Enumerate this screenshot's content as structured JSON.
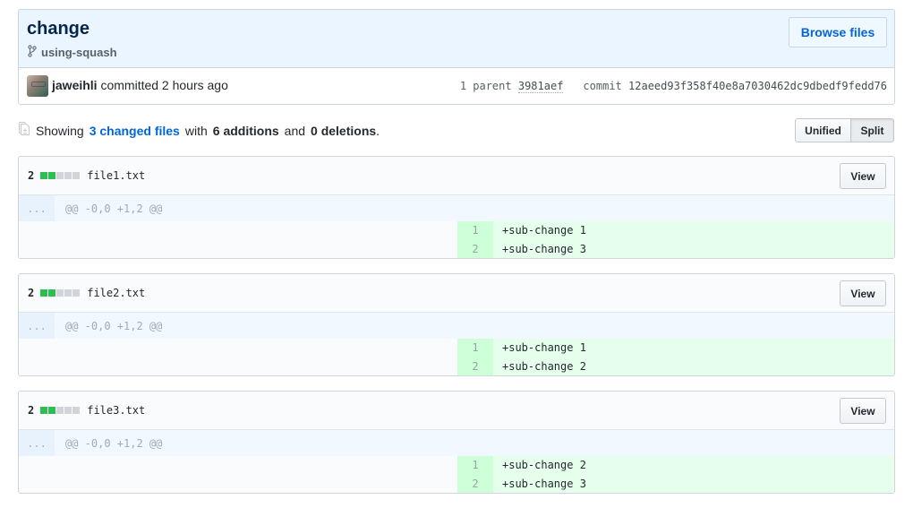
{
  "commit": {
    "title": "change",
    "branch": "using-squash",
    "browse_files_label": "Browse files",
    "author": "jaweihli",
    "committed_text": "committed 2 hours ago",
    "parent_count_label": "1 parent",
    "parent_sha": "3981aef",
    "commit_label": "commit",
    "commit_sha": "12aeed93f358f40e8a7030462dc9dbedf9fedd76"
  },
  "summary": {
    "prefix": "Showing",
    "changed_files_link": "3 changed files",
    "with": "with",
    "additions": "6 additions",
    "and": "and",
    "deletions": "0 deletions",
    "period": "."
  },
  "view_toggle": {
    "unified_label": "Unified",
    "split_label": "Split",
    "selected": "Split"
  },
  "colors": {
    "link": "#0366d6",
    "addition": "#2cbe4e",
    "addition_bg": "#e6ffed",
    "addition_num_bg": "#cdffd8",
    "hunk_bg": "#f1f8ff"
  },
  "files": [
    {
      "changes": "2",
      "diffstat": [
        "add",
        "add",
        "neutral",
        "neutral",
        "neutral"
      ],
      "name": "file1.txt",
      "view_label": "View",
      "hunk_expand": "...",
      "hunk_header": "@@ -0,0 +1,2 @@",
      "lines": [
        {
          "num": "1",
          "text": "+sub-change 1"
        },
        {
          "num": "2",
          "text": "+sub-change 3"
        }
      ]
    },
    {
      "changes": "2",
      "diffstat": [
        "add",
        "add",
        "neutral",
        "neutral",
        "neutral"
      ],
      "name": "file2.txt",
      "view_label": "View",
      "hunk_expand": "...",
      "hunk_header": "@@ -0,0 +1,2 @@",
      "lines": [
        {
          "num": "1",
          "text": "+sub-change 1"
        },
        {
          "num": "2",
          "text": "+sub-change 2"
        }
      ]
    },
    {
      "changes": "2",
      "diffstat": [
        "add",
        "add",
        "neutral",
        "neutral",
        "neutral"
      ],
      "name": "file3.txt",
      "view_label": "View",
      "hunk_expand": "...",
      "hunk_header": "@@ -0,0 +1,2 @@",
      "lines": [
        {
          "num": "1",
          "text": "+sub-change 2"
        },
        {
          "num": "2",
          "text": "+sub-change 3"
        }
      ]
    }
  ]
}
